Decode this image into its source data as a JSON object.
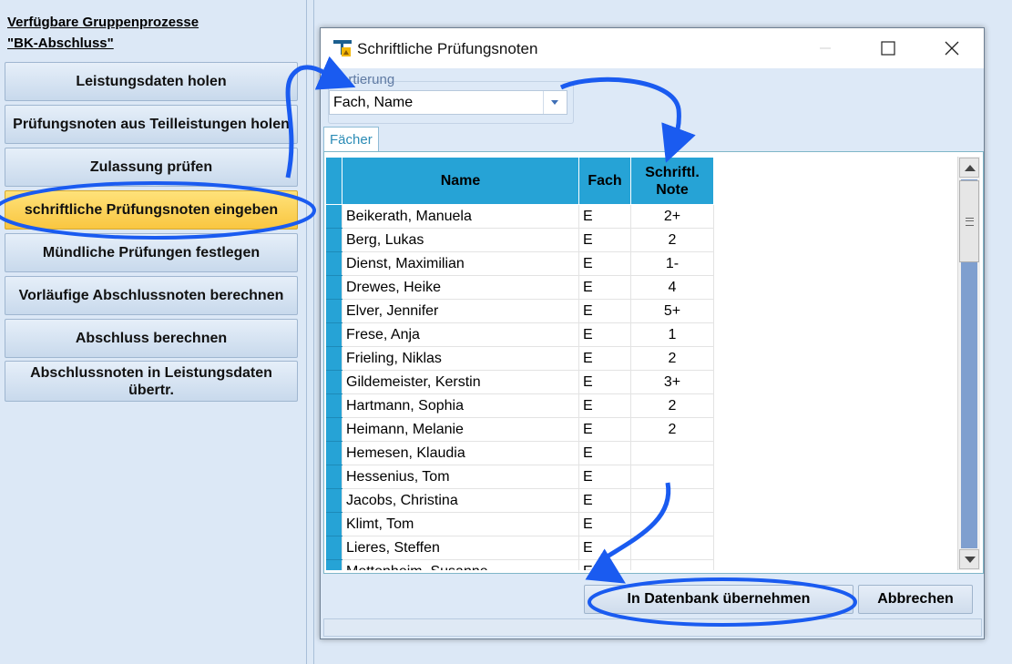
{
  "panel": {
    "title_line1": "Verfügbare Gruppenprozesse",
    "title_line2": "\"BK-Abschluss\"",
    "buttons": [
      {
        "label": "Leistungsdaten holen"
      },
      {
        "label": "Prüfungsnoten aus Teilleistungen holen"
      },
      {
        "label": "Zulassung prüfen"
      },
      {
        "label": "schriftliche Prüfungsnoten eingeben"
      },
      {
        "label": "Mündliche Prüfungen festlegen"
      },
      {
        "label": "Vorläufige Abschlussnoten berechnen"
      },
      {
        "label": "Abschluss berechnen"
      },
      {
        "label": "Abschlussnoten in Leistungsdaten übertr."
      }
    ]
  },
  "dialog": {
    "title": "Schriftliche Prüfungsnoten",
    "sort_label": "Sortierung",
    "sort_value": "Fach, Name",
    "tab_label": "Fächer",
    "columns": {
      "name": "Name",
      "fach": "Fach",
      "note": "Schriftl. Note"
    },
    "rows": [
      {
        "name": "Beikerath, Manuela",
        "fach": "E",
        "note": "2+"
      },
      {
        "name": "Berg, Lukas",
        "fach": "E",
        "note": "2"
      },
      {
        "name": "Dienst, Maximilian",
        "fach": "E",
        "note": "1-"
      },
      {
        "name": "Drewes, Heike",
        "fach": "E",
        "note": "4"
      },
      {
        "name": "Elver, Jennifer",
        "fach": "E",
        "note": "5+"
      },
      {
        "name": "Frese, Anja",
        "fach": "E",
        "note": "1"
      },
      {
        "name": "Frieling, Niklas",
        "fach": "E",
        "note": "2"
      },
      {
        "name": "Gildemeister, Kerstin",
        "fach": "E",
        "note": "3+"
      },
      {
        "name": "Hartmann, Sophia",
        "fach": "E",
        "note": "2"
      },
      {
        "name": "Heimann, Melanie",
        "fach": "E",
        "note": "2"
      },
      {
        "name": "Hemesen, Klaudia",
        "fach": "E",
        "note": ""
      },
      {
        "name": "Hessenius, Tom",
        "fach": "E",
        "note": ""
      },
      {
        "name": "Jacobs, Christina",
        "fach": "E",
        "note": ""
      },
      {
        "name": "Klimt, Tom",
        "fach": "E",
        "note": ""
      },
      {
        "name": "Lieres, Steffen",
        "fach": "E",
        "note": ""
      },
      {
        "name": "Mettenheim, Susanne",
        "fach": "E",
        "note": ""
      }
    ],
    "confirm_label": "In Datenbank übernehmen",
    "cancel_label": "Abbrechen"
  },
  "colors": {
    "highlight": "#f9c640",
    "header": "#26a3d6",
    "annotation": "#1a5bf0"
  }
}
